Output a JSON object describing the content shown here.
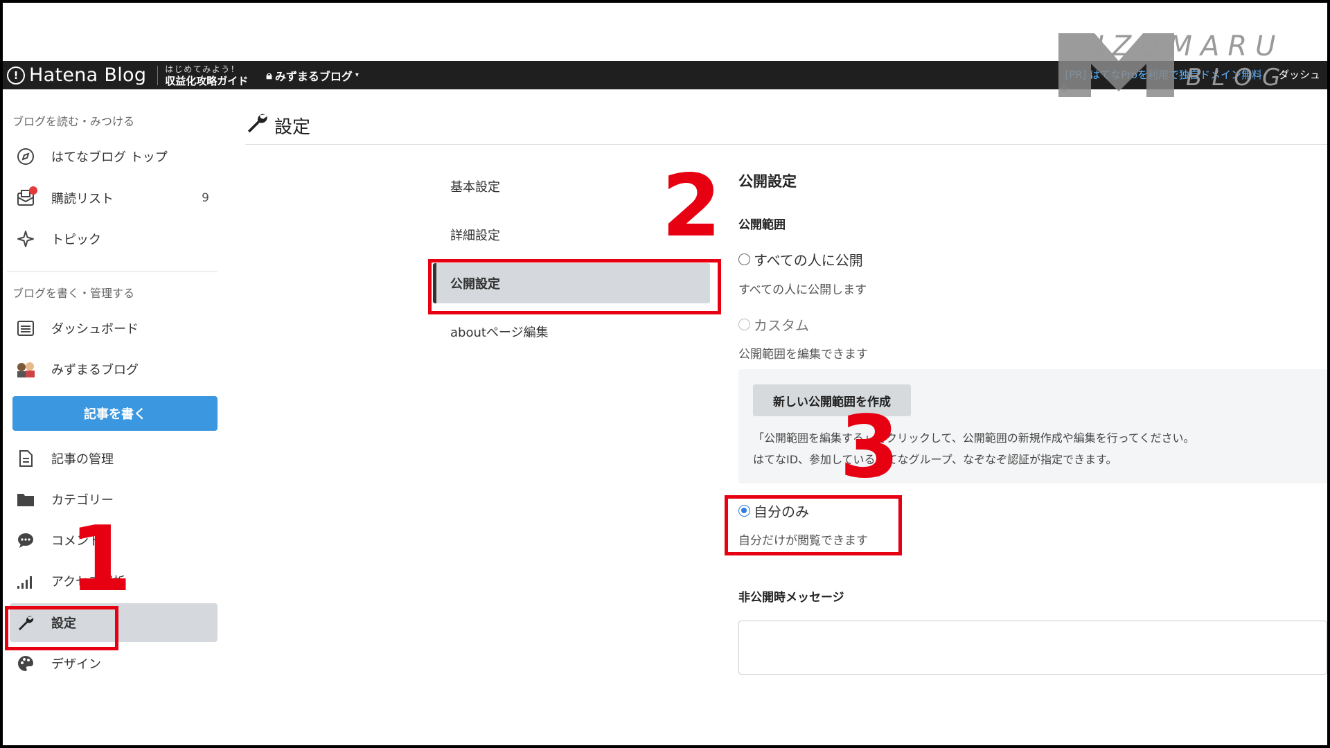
{
  "topbar": {
    "brand_name": "Hatena Blog",
    "guide_line1": "はじめてみよう！",
    "guide_line2": "収益化攻略ガイド",
    "blog_switch": "みずまるブログ",
    "promo_text": "[PR] はてなProを利用で独自ドメイン無料",
    "promo_dash": "ダッシュ"
  },
  "watermark": {
    "line1": "IZUMARU",
    "line2": "BLOG"
  },
  "sidebar": {
    "section_read": "ブログを読む・みつける",
    "top": "はてなブログ トップ",
    "subscriptions": "購読リスト",
    "subscriptions_count": "9",
    "topics": "トピック",
    "section_write": "ブログを書く・管理する",
    "dashboard": "ダッシュボード",
    "blog": "みずまるブログ",
    "write_button": "記事を書く",
    "articles": "記事の管理",
    "categories": "カテゴリー",
    "comments": "コメント",
    "analytics": "アクセス解析",
    "settings": "設定",
    "design": "デザイン"
  },
  "main": {
    "title": "設定",
    "subnav": {
      "basic": "基本設定",
      "advanced": "詳細設定",
      "publish": "公開設定",
      "about": "aboutページ編集"
    },
    "panel": {
      "heading": "公開設定",
      "scope_label": "公開範囲",
      "opt_all": "すべての人に公開",
      "opt_all_desc": "すべての人に公開します",
      "opt_custom": "カスタム",
      "opt_custom_desc": "公開範囲を編集できます",
      "create_button": "新しい公開範囲を作成",
      "custom_text1": "「公開範囲を編集する」をクリックして、公開範囲の新規作成や編集を行ってください。",
      "custom_text2": "はてなID、参加しているはてなグループ、なぞなぞ認証が指定できます。",
      "opt_me": "自分のみ",
      "opt_me_desc": "自分だけが閲覧できます",
      "private_msg_label": "非公開時メッセージ"
    }
  },
  "annotations": {
    "n1": "1",
    "n2": "2",
    "n3": "3",
    "color": "#e60012"
  },
  "colors": {
    "topbar": "#1f1f1f",
    "primary_button": "#3a97e0",
    "active_bg": "#d5d8dc",
    "radio_selected": "#2e7de0"
  }
}
